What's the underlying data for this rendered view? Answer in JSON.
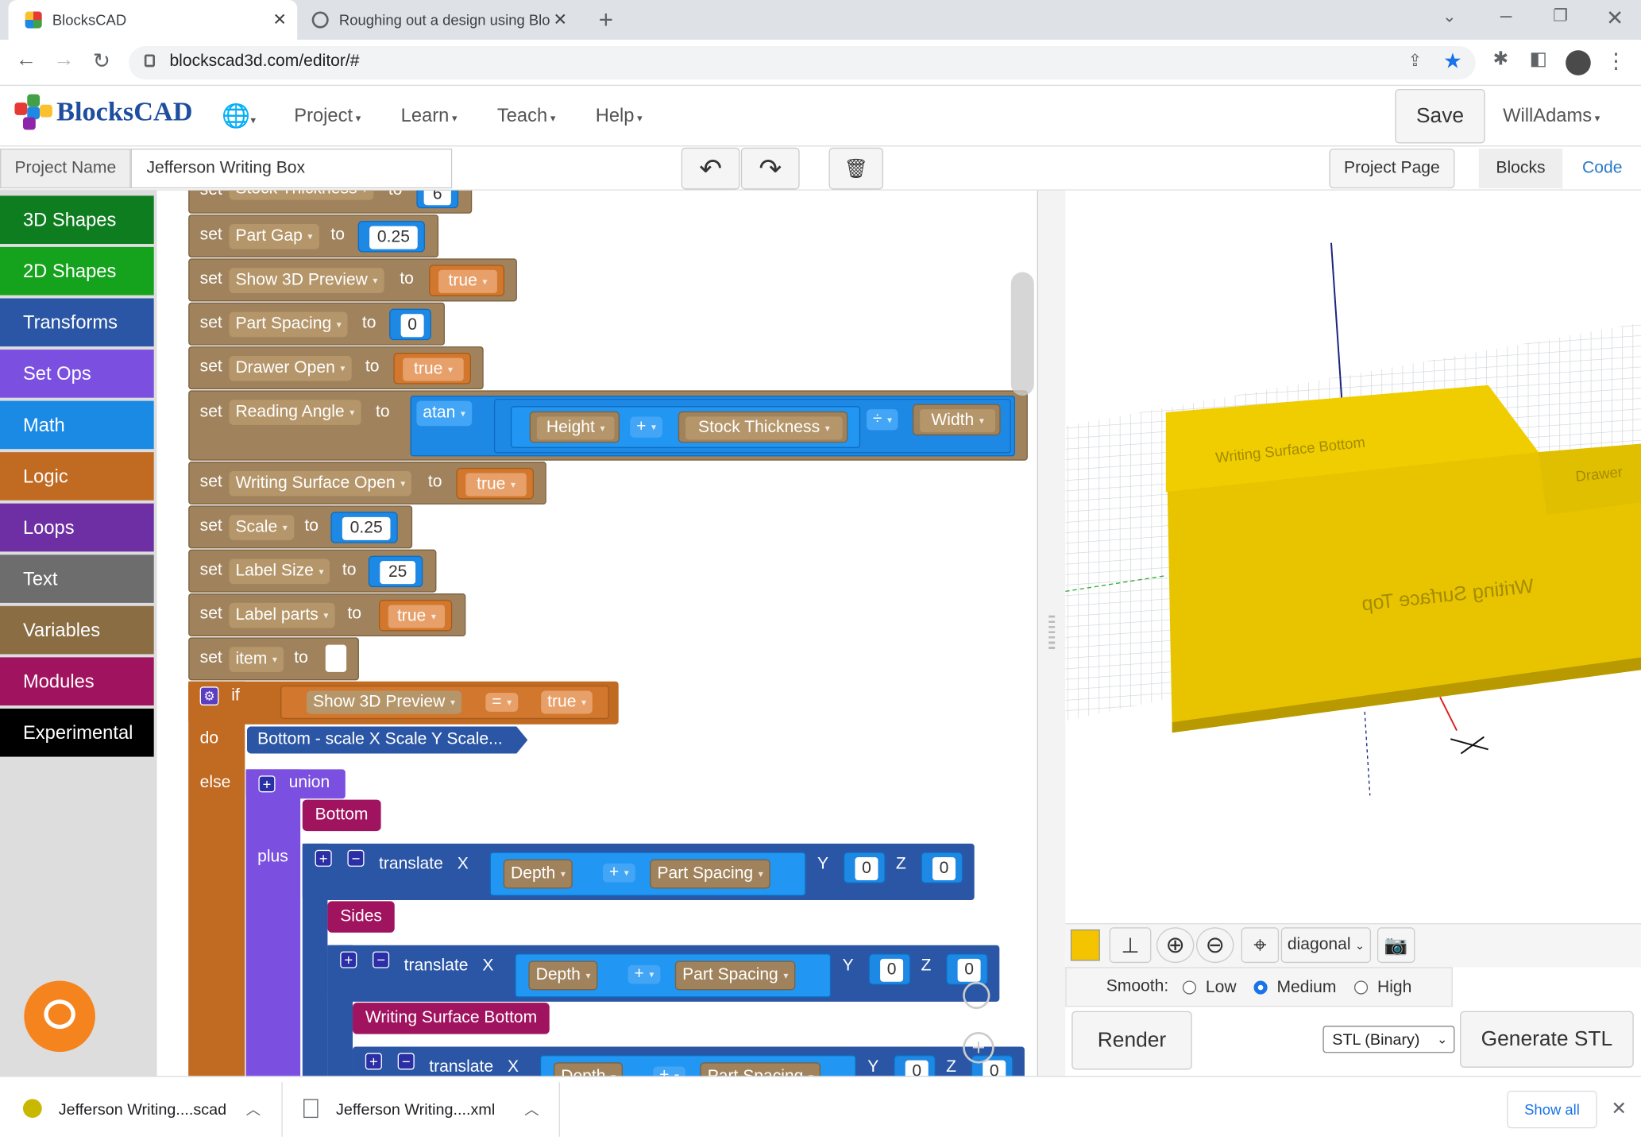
{
  "browser": {
    "tabs": [
      {
        "title": "BlocksCAD",
        "active": true
      },
      {
        "title": "Roughing out a design using Blo",
        "active": false
      }
    ],
    "url": "blockscad3d.com/editor/#"
  },
  "app": {
    "logo": "BlocksCAD",
    "menus": [
      "Project",
      "Learn",
      "Teach",
      "Help"
    ],
    "save": "Save",
    "user": "WillAdams",
    "project_name_label": "Project Name",
    "project_name": "Jefferson Writing Box",
    "project_page": "Project Page",
    "view_tabs": [
      "Blocks",
      "Code"
    ]
  },
  "toolbox": [
    {
      "label": "3D Shapes",
      "color": "#0e7d1f"
    },
    {
      "label": "2D Shapes",
      "color": "#15a21c"
    },
    {
      "label": "Transforms",
      "color": "#2b56a5"
    },
    {
      "label": "Set Ops",
      "color": "#7b4fe0"
    },
    {
      "label": "Math",
      "color": "#1b8ae4"
    },
    {
      "label": "Logic",
      "color": "#c06a22"
    },
    {
      "label": "Loops",
      "color": "#6d2fa3"
    },
    {
      "label": "Text",
      "color": "#6d6d6d"
    },
    {
      "label": "Variables",
      "color": "#8a6d43"
    },
    {
      "label": "Modules",
      "color": "#a0135f"
    },
    {
      "label": "Experimental",
      "color": "#000000"
    }
  ],
  "blocks": {
    "set_word": "set",
    "to_word": "to",
    "sets": [
      {
        "var": "Stock Thickness",
        "value": "6"
      },
      {
        "var": "Part Gap",
        "value": "0.25"
      },
      {
        "var": "Show 3D Preview",
        "value": "true"
      },
      {
        "var": "Part Spacing",
        "value": "0"
      },
      {
        "var": "Drawer Open",
        "value": "true"
      },
      {
        "var": "Reading Angle",
        "value": "atan"
      },
      {
        "var": "Writing Surface Open",
        "value": "true"
      },
      {
        "var": "Scale",
        "value": "0.25"
      },
      {
        "var": "Label Size",
        "value": "25"
      },
      {
        "var": "Label parts",
        "value": "true"
      },
      {
        "var": "item",
        "value": ""
      }
    ],
    "reading": {
      "height": "Height",
      "plus": "+",
      "stock": "Stock Thickness",
      "div": "÷",
      "width": "Width"
    },
    "if_word": "if",
    "do_word": "do",
    "else_word": "else",
    "cond": {
      "var": "Show 3D Preview",
      "op": "=",
      "val": "true"
    },
    "do_call": "Bottom - scale X Scale Y Scale...",
    "union": "union",
    "plus_word": "plus",
    "bottom": "Bottom",
    "sides": "Sides",
    "wsb": "Writing Surface Bottom",
    "translate": {
      "word": "translate",
      "x": "X",
      "y": "Y",
      "z": "Z",
      "depth": "Depth",
      "plus": "+",
      "spacing": "Part Spacing",
      "zero": "0"
    }
  },
  "viewer": {
    "labels": [
      "Writing Surface Bottom",
      "Writing Surface Top",
      "Drawer"
    ],
    "view_select": "diagonal",
    "smooth_label": "Smooth:",
    "smooth_opts": [
      "Low",
      "Medium",
      "High"
    ],
    "smooth_selected": "Medium",
    "render": "Render",
    "format": "STL (Binary)",
    "generate": "Generate STL",
    "color_swatch": "#f5c400"
  },
  "downloads": {
    "items": [
      "Jefferson Writing....scad",
      "Jefferson Writing....xml"
    ],
    "show_all": "Show all"
  }
}
